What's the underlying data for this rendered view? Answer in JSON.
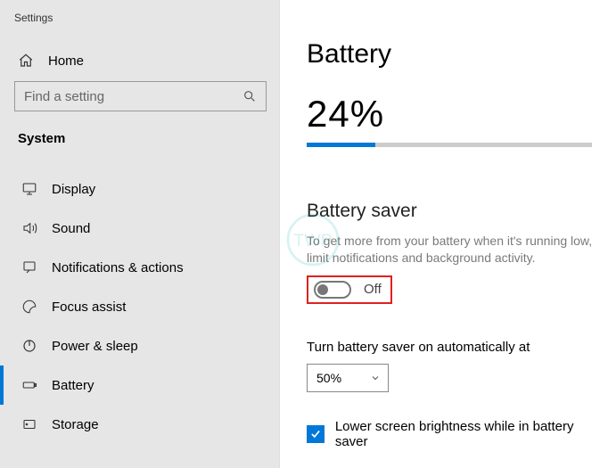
{
  "app": {
    "title": "Settings"
  },
  "sidebar": {
    "home": "Home",
    "search_placeholder": "Find a setting",
    "section": "System",
    "items": [
      {
        "label": "Display"
      },
      {
        "label": "Sound"
      },
      {
        "label": "Notifications & actions"
      },
      {
        "label": "Focus assist"
      },
      {
        "label": "Power & sleep"
      },
      {
        "label": "Battery"
      },
      {
        "label": "Storage"
      }
    ]
  },
  "page": {
    "title": "Battery",
    "percent_text": "24%",
    "percent_value": 24,
    "saver": {
      "title": "Battery saver",
      "help": "To get more from your battery when it's running low, limit notifications and background activity.",
      "state": "Off"
    },
    "auto": {
      "label": "Turn battery saver on automatically at",
      "value": "50%"
    },
    "lower_brightness": {
      "checked": true,
      "label": "Lower screen brightness while in battery saver"
    }
  }
}
